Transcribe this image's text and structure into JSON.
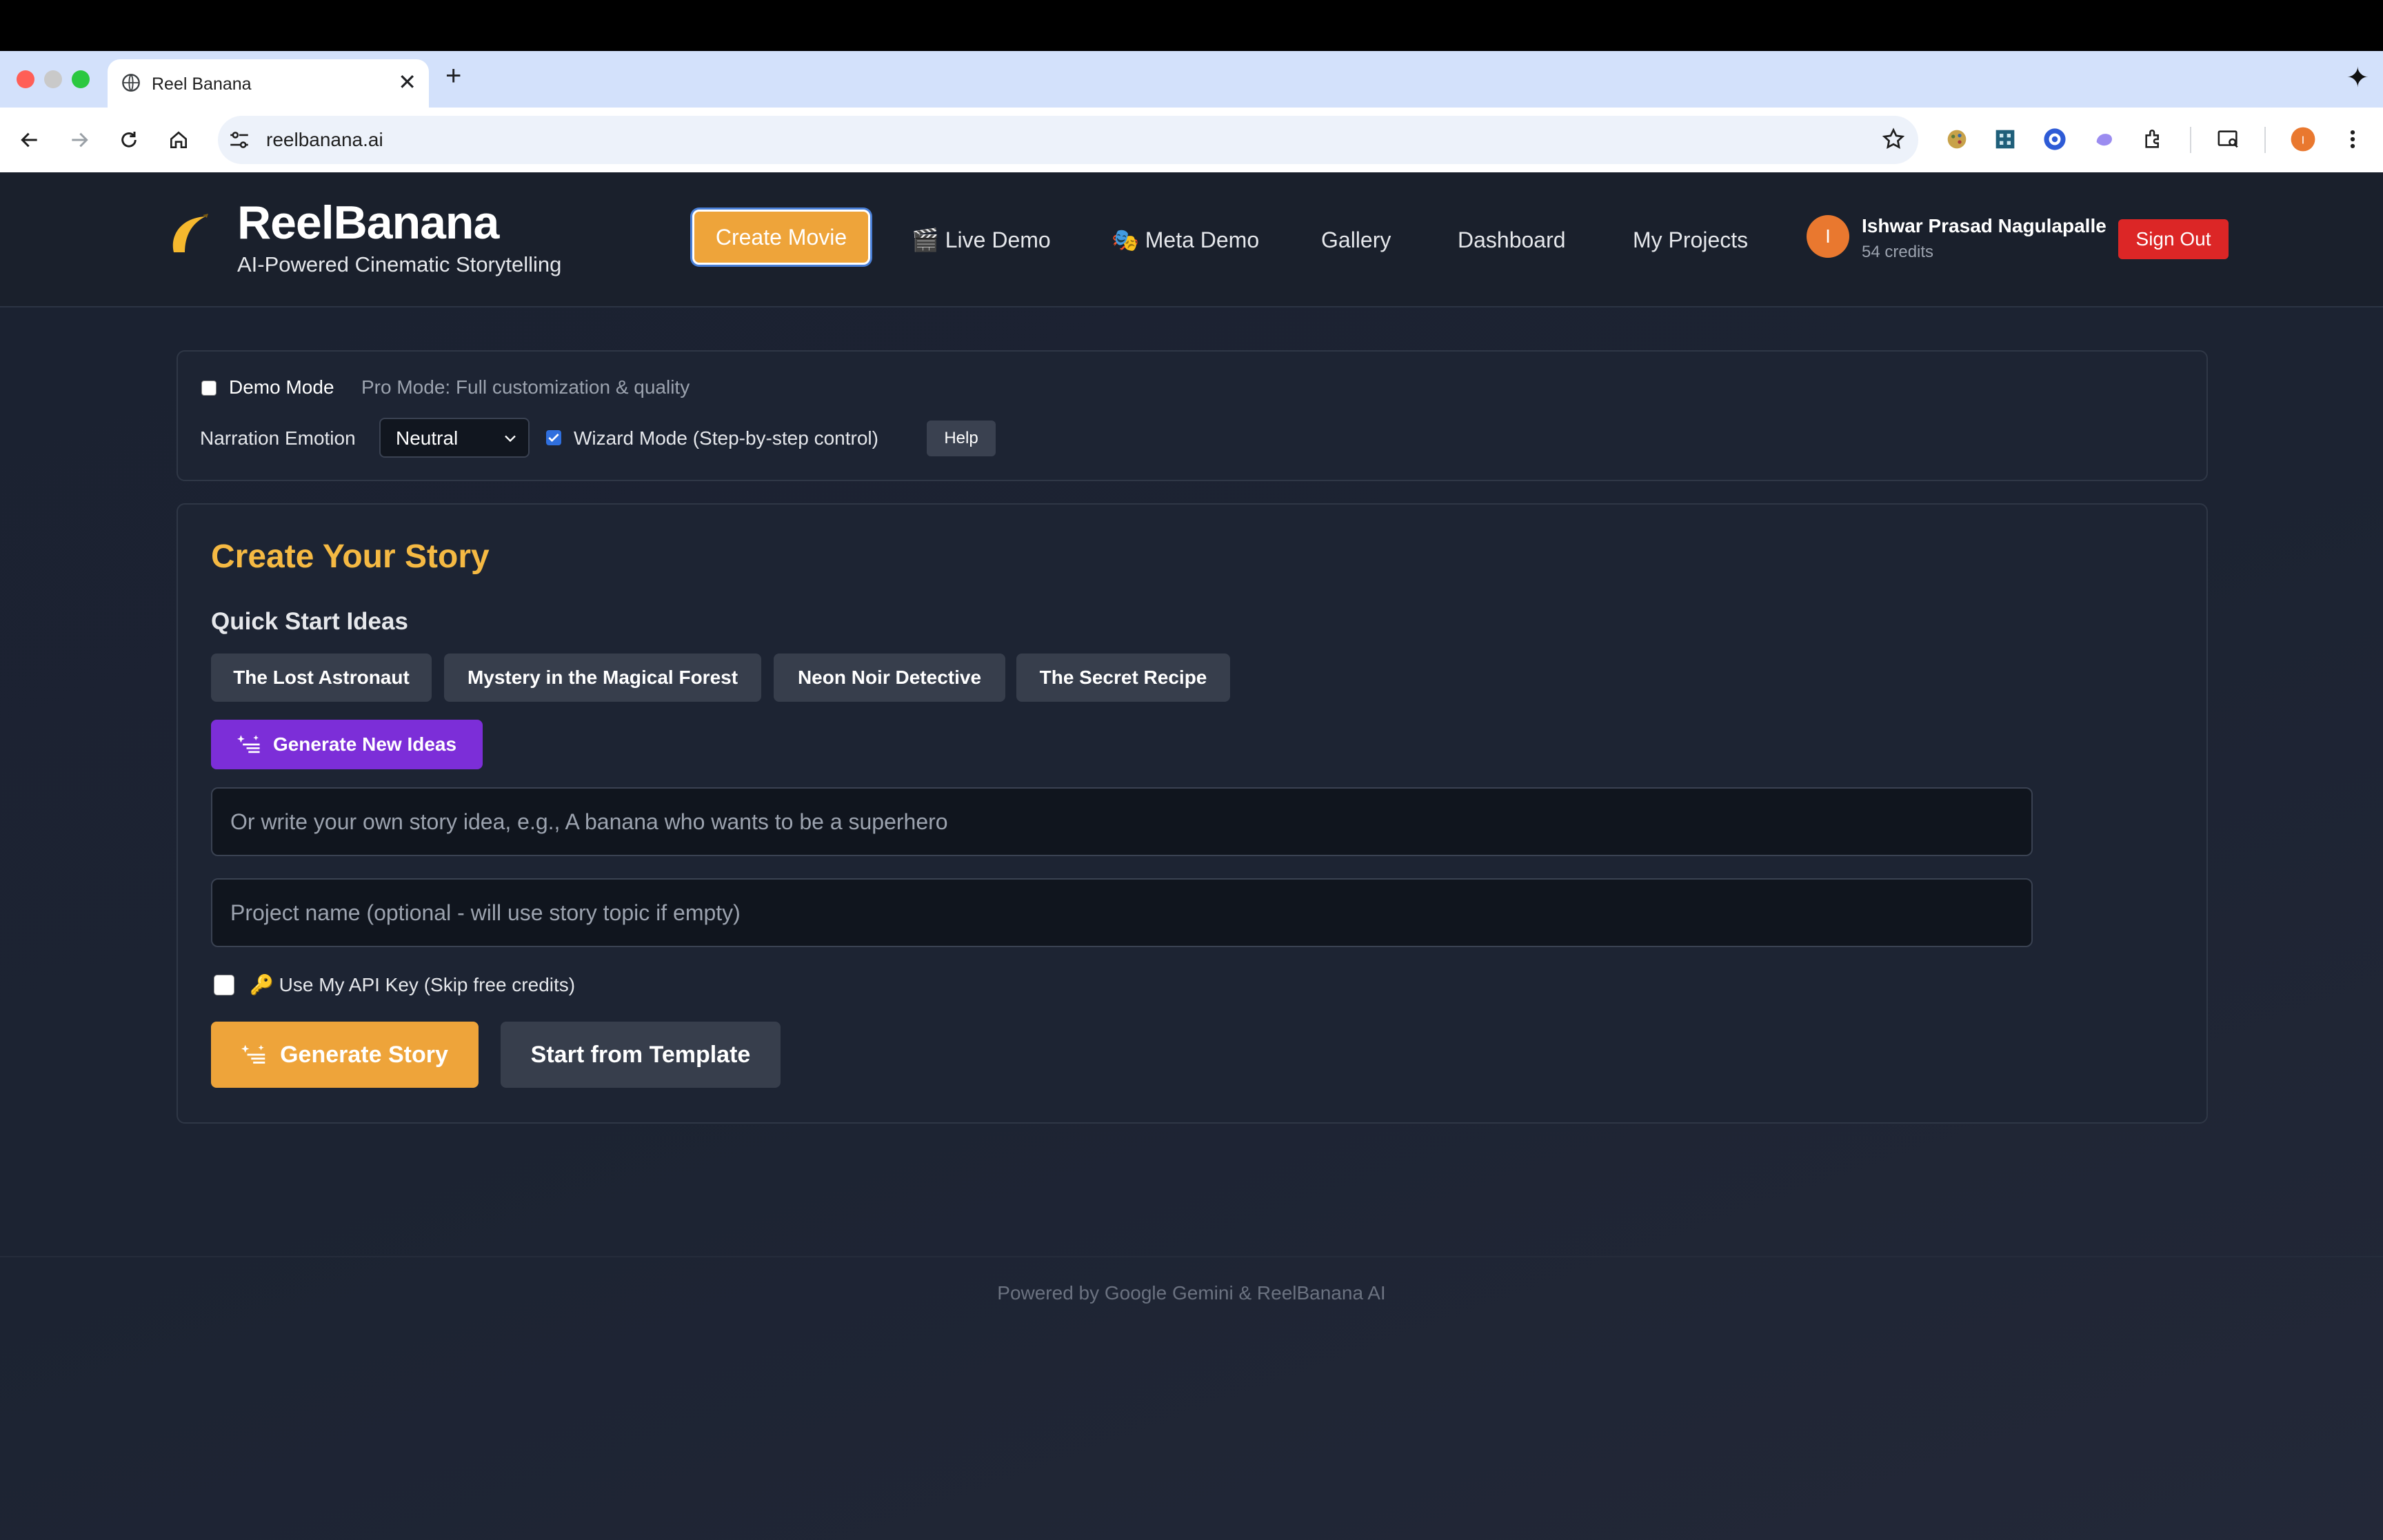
{
  "browser": {
    "tab_title": "Reel Banana",
    "url": "reelbanana.ai",
    "colors": {
      "close": "#ff5f57",
      "minimize": "#febc2e",
      "zoom": "#28c840"
    }
  },
  "header": {
    "brand": "ReelBanana",
    "tagline": "AI-Powered Cinematic Storytelling",
    "nav": {
      "create": "Create Movie",
      "live_demo": "🎬 Live Demo",
      "meta_demo": "🎭 Meta Demo",
      "gallery": "Gallery",
      "dashboard": "Dashboard",
      "projects": "My Projects"
    },
    "user": {
      "initial": "I",
      "name": "Ishwar Prasad Nagulapalle",
      "credits": "54 credits"
    },
    "sign_out": "Sign Out"
  },
  "settings": {
    "demo_mode_label": "Demo Mode",
    "demo_mode_checked": false,
    "pro_mode_text": "Pro Mode: Full customization & quality",
    "emotion_label": "Narration Emotion",
    "emotion_value": "Neutral",
    "wizard_label": "Wizard Mode (Step-by-step control)",
    "wizard_checked": true,
    "help": "Help"
  },
  "story": {
    "title": "Create Your Story",
    "quick_start": "Quick Start Ideas",
    "ideas": [
      "The Lost Astronaut",
      "Mystery in the Magical Forest",
      "Neon Noir Detective",
      "The Secret Recipe"
    ],
    "generate_ideas": "Generate New Ideas",
    "idea_placeholder": "Or write your own story idea, e.g., A banana who wants to be a superhero",
    "project_placeholder": "Project name (optional - will use story topic if empty)",
    "api_key_label": "🔑 Use My API Key (Skip free credits)",
    "api_key_checked": false,
    "generate_story": "Generate Story",
    "start_template": "Start from Template"
  },
  "footer": "Powered by Google Gemini & ReelBanana AI",
  "theme": {
    "accent": "#eea43a",
    "title_yellow": "#f5b943",
    "purple": "#7c2ed8",
    "danger": "#dc2626"
  }
}
